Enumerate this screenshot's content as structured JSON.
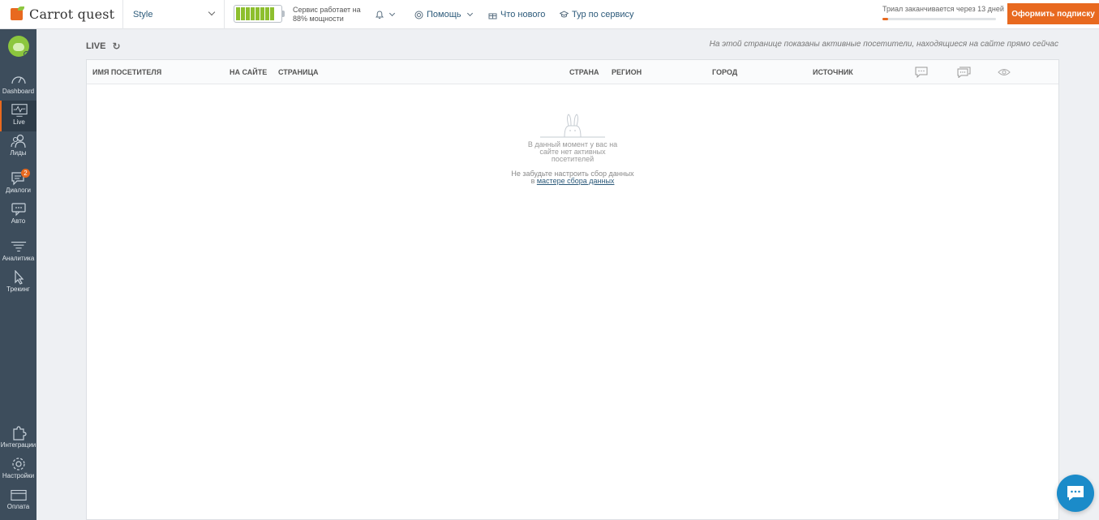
{
  "header": {
    "logo_text": "Carrot quest",
    "app_select": "Style",
    "power": {
      "line1": "Сервис работает на",
      "line2": "88% мощности",
      "battery_level": 0.88
    },
    "nav": {
      "notifications_icon": "bell-icon",
      "help": "Помощь",
      "whats_new": "Что нового",
      "tour": "Тур по сервису"
    },
    "trial": {
      "text": "Триал заканчивается через 13 дней",
      "progress": 0.05
    },
    "subscribe_label": "Оформить подписку"
  },
  "sidebar": {
    "items": [
      {
        "label": "Dashboard",
        "icon": "gauge-icon"
      },
      {
        "label": "Live",
        "icon": "monitor-pulse-icon"
      },
      {
        "label": "Лиды",
        "icon": "users-icon"
      },
      {
        "label": "Диалоги",
        "icon": "chat-icon",
        "badge": "2"
      },
      {
        "label": "Авто",
        "icon": "auto-message-icon"
      },
      {
        "label": "Аналитика",
        "icon": "funnel-icon"
      },
      {
        "label": "Трекинг",
        "icon": "cursor-icon"
      }
    ],
    "bottom_items": [
      {
        "label": "Интеграции",
        "icon": "puzzle-icon"
      },
      {
        "label": "Настройки",
        "icon": "gear-icon"
      },
      {
        "label": "Оплата",
        "icon": "card-icon"
      }
    ]
  },
  "main": {
    "title": "LIVE",
    "note": "На этой странице показаны активные посетители, находящиеся на сайте прямо сейчас",
    "columns": {
      "name": "Имя посетителя",
      "on_site": "На сайте",
      "page": "Страница",
      "country": "Страна",
      "region": "Регион",
      "city": "Город",
      "source": "Источник"
    },
    "empty": {
      "line1": "В данный момент у вас на",
      "line2": "сайте нет активных",
      "line3": "посетителей",
      "hint1": "Не забудьте настроить сбор данных",
      "hint2_prefix": "в",
      "hint2_link": "мастере сбора данных"
    }
  },
  "colors": {
    "accent": "#e8691f",
    "sidebar": "#3d4d5c",
    "battery": "#8dbf2e",
    "link": "#2c5a7a",
    "chat": "#1b8bc9"
  }
}
